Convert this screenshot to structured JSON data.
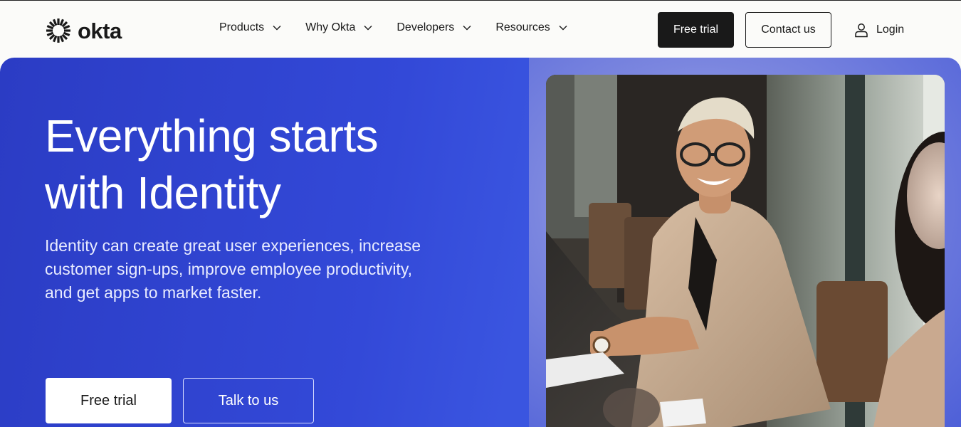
{
  "brand": {
    "name": "okta"
  },
  "nav": {
    "items": [
      {
        "label": "Products"
      },
      {
        "label": "Why Okta"
      },
      {
        "label": "Developers"
      },
      {
        "label": "Resources"
      }
    ]
  },
  "header": {
    "free_trial_label": "Free trial",
    "contact_label": "Contact us",
    "login_label": "Login"
  },
  "hero": {
    "headline_line1": "Everything starts",
    "headline_line2": "with Identity",
    "subtext": "Identity can create great user experiences, increase customer sign-ups, improve employee productivity, and get apps to market faster.",
    "free_trial_label": "Free trial",
    "talk_label": "Talk to us"
  },
  "icons": {
    "logo": "okta-sunburst-icon",
    "chevron": "chevron-down-icon",
    "user": "user-icon"
  },
  "colors": {
    "hero_blue": "#3349d8",
    "ink": "#191919",
    "header_bg": "#fbfbf9"
  }
}
